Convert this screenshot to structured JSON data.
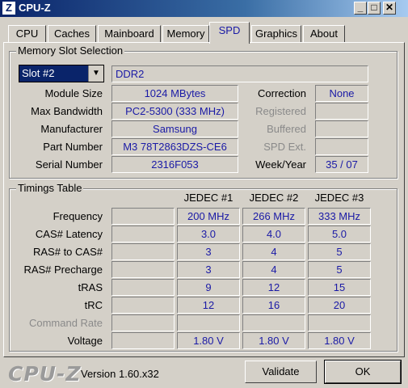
{
  "window": {
    "title": "CPU-Z",
    "icon_letter": "Z",
    "controls": {
      "minimize": "_",
      "maximize": "□",
      "close": "✕"
    }
  },
  "tabs": [
    {
      "label": "CPU"
    },
    {
      "label": "Caches"
    },
    {
      "label": "Mainboard"
    },
    {
      "label": "Memory"
    },
    {
      "label": "SPD"
    },
    {
      "label": "Graphics"
    },
    {
      "label": "About"
    }
  ],
  "active_tab": "SPD",
  "slot_selection": {
    "legend": "Memory Slot Selection",
    "slot_value": "Slot #2",
    "memory_type": "DDR2",
    "rows": {
      "module_size": {
        "label": "Module Size",
        "value": "1024 MBytes"
      },
      "max_bandwidth": {
        "label": "Max Bandwidth",
        "value": "PC2-5300 (333 MHz)"
      },
      "manufacturer": {
        "label": "Manufacturer",
        "value": "Samsung"
      },
      "part_number": {
        "label": "Part Number",
        "value": "M3 78T2863DZS-CE6"
      },
      "serial_number": {
        "label": "Serial Number",
        "value": "2316F053"
      }
    },
    "right": {
      "correction": {
        "label": "Correction",
        "value": "None"
      },
      "registered": {
        "label": "Registered",
        "value": ""
      },
      "buffered": {
        "label": "Buffered",
        "value": ""
      },
      "spd_ext": {
        "label": "SPD Ext.",
        "value": ""
      },
      "week_year": {
        "label": "Week/Year",
        "value": "35 / 07"
      }
    }
  },
  "timings": {
    "legend": "Timings Table",
    "columns": [
      "JEDEC #1",
      "JEDEC #2",
      "JEDEC #3"
    ],
    "rows": [
      {
        "label": "Frequency",
        "values": [
          "200 MHz",
          "266 MHz",
          "333 MHz"
        ],
        "disabled": false
      },
      {
        "label": "CAS# Latency",
        "values": [
          "3.0",
          "4.0",
          "5.0"
        ],
        "disabled": false
      },
      {
        "label": "RAS# to CAS#",
        "values": [
          "3",
          "4",
          "5"
        ],
        "disabled": false
      },
      {
        "label": "RAS# Precharge",
        "values": [
          "3",
          "4",
          "5"
        ],
        "disabled": false
      },
      {
        "label": "tRAS",
        "values": [
          "9",
          "12",
          "15"
        ],
        "disabled": false
      },
      {
        "label": "tRC",
        "values": [
          "12",
          "16",
          "20"
        ],
        "disabled": false
      },
      {
        "label": "Command Rate",
        "values": [
          "",
          "",
          ""
        ],
        "disabled": true
      },
      {
        "label": "Voltage",
        "values": [
          "1.80 V",
          "1.80 V",
          "1.80 V"
        ],
        "disabled": false
      }
    ]
  },
  "footer": {
    "logo": "CPU-Z",
    "version": "Version 1.60.x32",
    "validate_label": "Validate",
    "ok_label": "OK"
  },
  "colors": {
    "title_bar": "#0a246a",
    "value_text": "#1a1aa6",
    "face": "#d4d0c8"
  }
}
